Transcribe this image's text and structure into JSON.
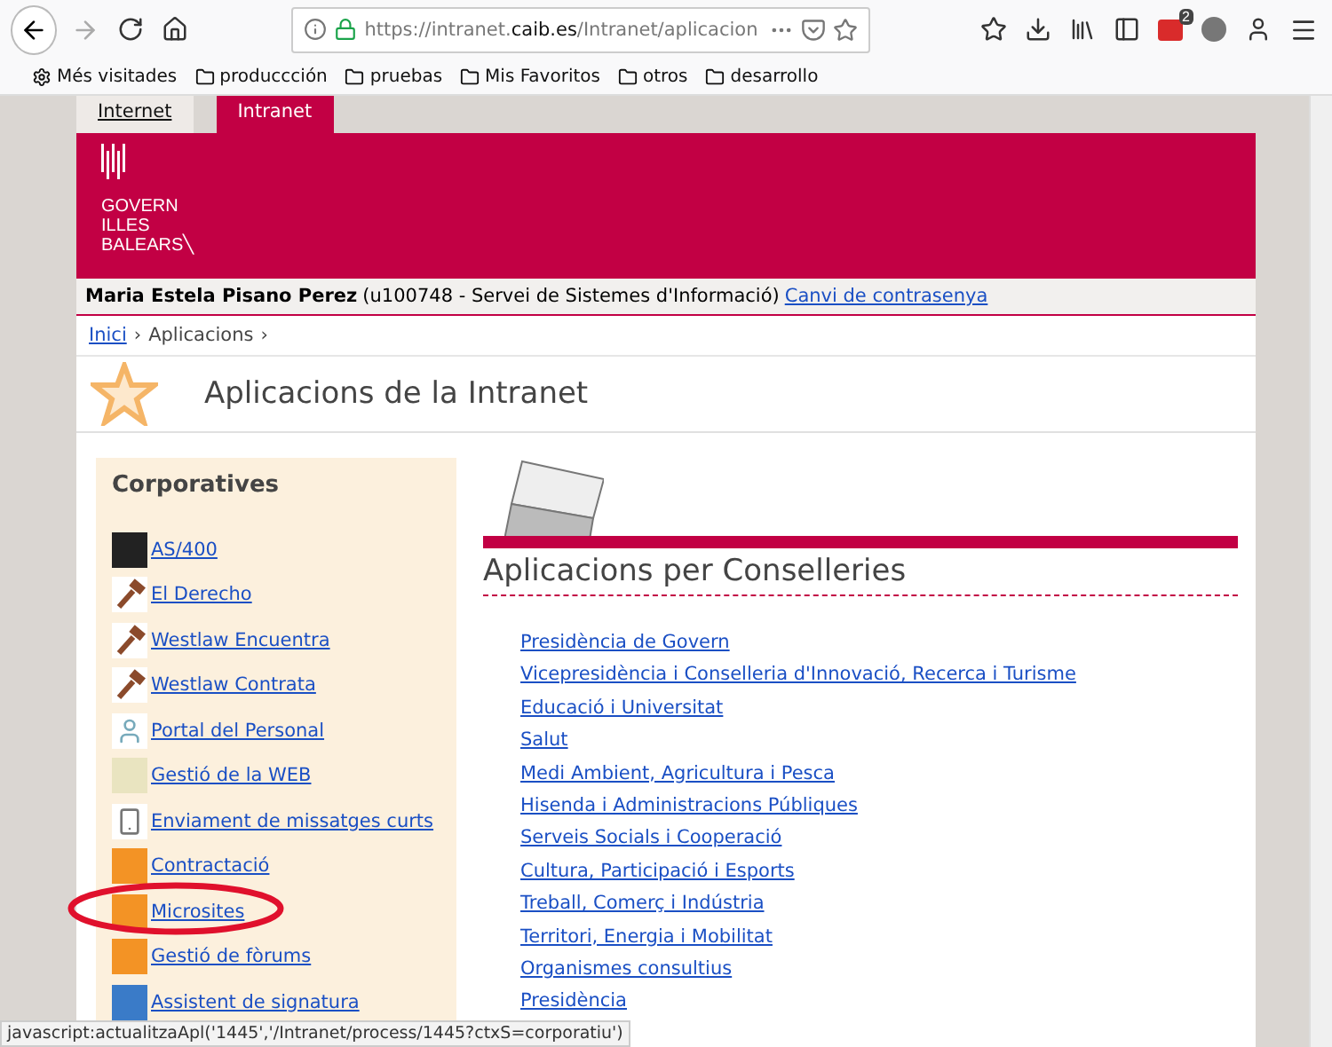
{
  "browser": {
    "url_prefix": "https://intranet.",
    "url_domain": "caib.es",
    "url_path": "/Intranet/aplicacion",
    "badge": "2",
    "bookmarks": [
      {
        "label": "Més visitades",
        "kind": "gear"
      },
      {
        "label": "produccción",
        "kind": "folder"
      },
      {
        "label": "pruebas",
        "kind": "folder"
      },
      {
        "label": "Mis Favoritos",
        "kind": "folder"
      },
      {
        "label": "otros",
        "kind": "folder"
      },
      {
        "label": "desarrollo",
        "kind": "folder"
      }
    ]
  },
  "site_tabs": [
    {
      "label": "Internet",
      "selected": false
    },
    {
      "label": "Intranet",
      "selected": true
    }
  ],
  "logo": [
    "GOVERN",
    "ILLES",
    "BALEARS╲"
  ],
  "user_bar": {
    "name": "Maria Estela Pisano Perez",
    "detail": "(u100748 - Servei de Sistemes d'Informació)",
    "link": "Canvi de contrasenya"
  },
  "breadcrumb_separator": "›",
  "breadcrumb": [
    {
      "label": "Inici",
      "link": true
    },
    {
      "label": "Aplicacions",
      "link": false
    }
  ],
  "page_title": "Aplicacions de la Intranet",
  "corporatives": {
    "title": "Corporatives",
    "items": [
      {
        "label": "AS/400",
        "kind": "server",
        "highlighted": false
      },
      {
        "label": "El Derecho",
        "kind": "gavel",
        "highlighted": false
      },
      {
        "label": "Westlaw Encuentra",
        "kind": "gavel",
        "highlighted": false
      },
      {
        "label": "Westlaw Contrata",
        "kind": "gavel",
        "highlighted": false
      },
      {
        "label": "Portal del Personal",
        "kind": "person",
        "highlighted": false
      },
      {
        "label": "Gestió de la WEB",
        "kind": "web",
        "highlighted": false
      },
      {
        "label": "Enviament de missatges curts",
        "kind": "phone",
        "highlighted": false
      },
      {
        "label": "Contractació",
        "kind": "orange",
        "highlighted": false
      },
      {
        "label": "Microsites",
        "kind": "orange",
        "highlighted": true
      },
      {
        "label": "Gestió de fòrums",
        "kind": "orange",
        "highlighted": false
      },
      {
        "label": "Assistent de signatura",
        "kind": "sign",
        "highlighted": false
      }
    ]
  },
  "conselleries": {
    "title": "Aplicacions per Conselleries",
    "links": [
      "Presidència de Govern",
      "Vicepresidència i Conselleria d'Innovació, Recerca i Turisme",
      "Educació i Universitat",
      "Salut",
      "Medi Ambient, Agricultura i Pesca",
      "Hisenda i Administracions Públiques",
      "Serveis Socials i Cooperació",
      "Cultura, Participació i Esports",
      "Treball, Comerç i Indústria",
      "Territori, Energia i Mobilitat",
      "Organismes consultius",
      "Presidència"
    ]
  },
  "status_bar": "javascript:actualitzaApl('1445','/Intranet/process/1445?ctxS=corporatiu')"
}
